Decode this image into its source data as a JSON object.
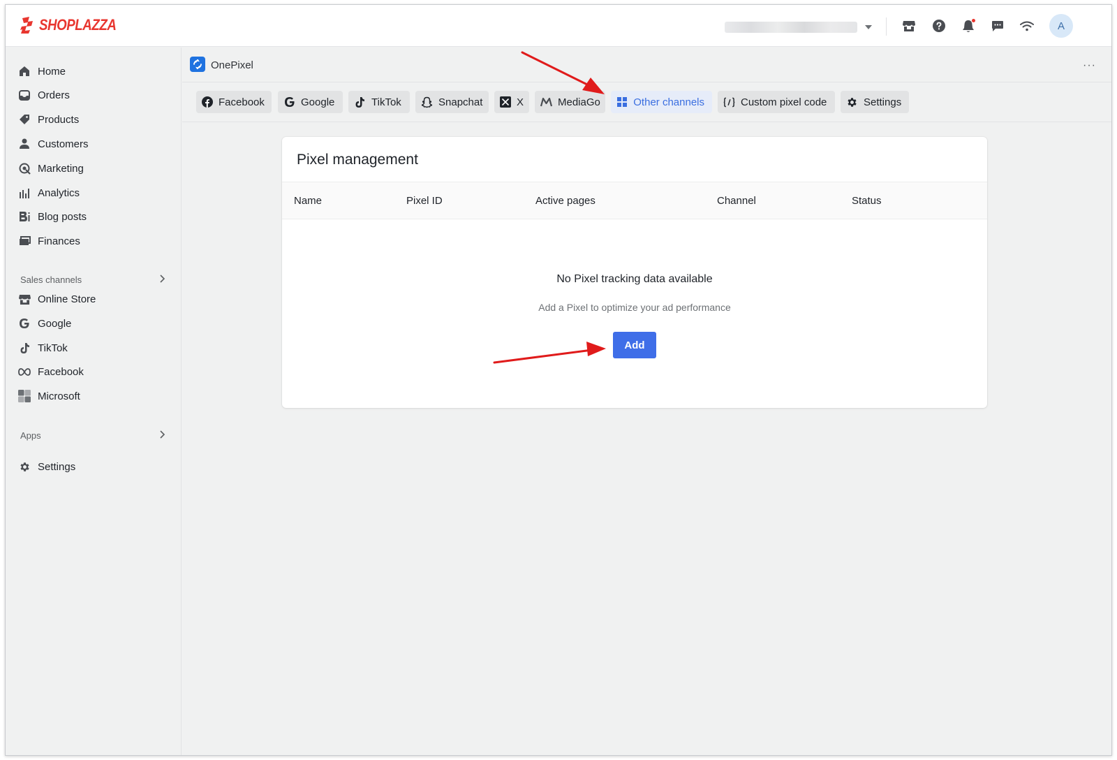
{
  "brand": {
    "logo_text": "SHOPLAZZA",
    "color": "#e8362f"
  },
  "topbar": {
    "icons": [
      "store-icon",
      "help-icon",
      "bell-icon",
      "chat-icon",
      "wifi-icon"
    ],
    "avatar_letter": "A"
  },
  "sidebar": {
    "items": [
      {
        "label": "Home",
        "icon": "home-icon"
      },
      {
        "label": "Orders",
        "icon": "orders-icon"
      },
      {
        "label": "Products",
        "icon": "tag-icon"
      },
      {
        "label": "Customers",
        "icon": "person-icon"
      },
      {
        "label": "Marketing",
        "icon": "marketing-icon"
      },
      {
        "label": "Analytics",
        "icon": "bar-chart-icon"
      },
      {
        "label": "Blog posts",
        "icon": "blog-icon"
      },
      {
        "label": "Finances",
        "icon": "finances-icon"
      }
    ],
    "sales_channels_title": "Sales channels",
    "channels": [
      {
        "label": "Online Store",
        "icon": "store-icon"
      },
      {
        "label": "Google",
        "icon": "google-icon"
      },
      {
        "label": "TikTok",
        "icon": "tiktok-icon"
      },
      {
        "label": "Facebook",
        "icon": "meta-icon"
      },
      {
        "label": "Microsoft",
        "icon": "microsoft-icon"
      }
    ],
    "apps_title": "Apps",
    "settings_label": "Settings"
  },
  "app": {
    "title": "OnePixel",
    "more": "···"
  },
  "tabs": [
    {
      "label": "Facebook",
      "icon": "facebook-icon"
    },
    {
      "label": "Google",
      "icon": "google-icon"
    },
    {
      "label": "TikTok",
      "icon": "tiktok-icon"
    },
    {
      "label": "Snapchat",
      "icon": "snapchat-icon"
    },
    {
      "label": "X",
      "icon": "x-icon"
    },
    {
      "label": "MediaGo",
      "icon": "mediago-icon"
    },
    {
      "label": "Other channels",
      "icon": "grid-icon",
      "active": true
    },
    {
      "label": "Custom pixel code",
      "icon": "code-icon"
    },
    {
      "label": "Settings",
      "icon": "gear-icon"
    }
  ],
  "card": {
    "title": "Pixel management",
    "columns": [
      "Name",
      "Pixel ID",
      "Active pages",
      "Channel",
      "Status"
    ],
    "empty_title": "No Pixel tracking data available",
    "empty_subtitle": "Add a Pixel to optimize your ad performance",
    "add_label": "Add"
  },
  "colors": {
    "accent": "#3f6ee8",
    "annotation_arrow": "#e01b1b"
  }
}
